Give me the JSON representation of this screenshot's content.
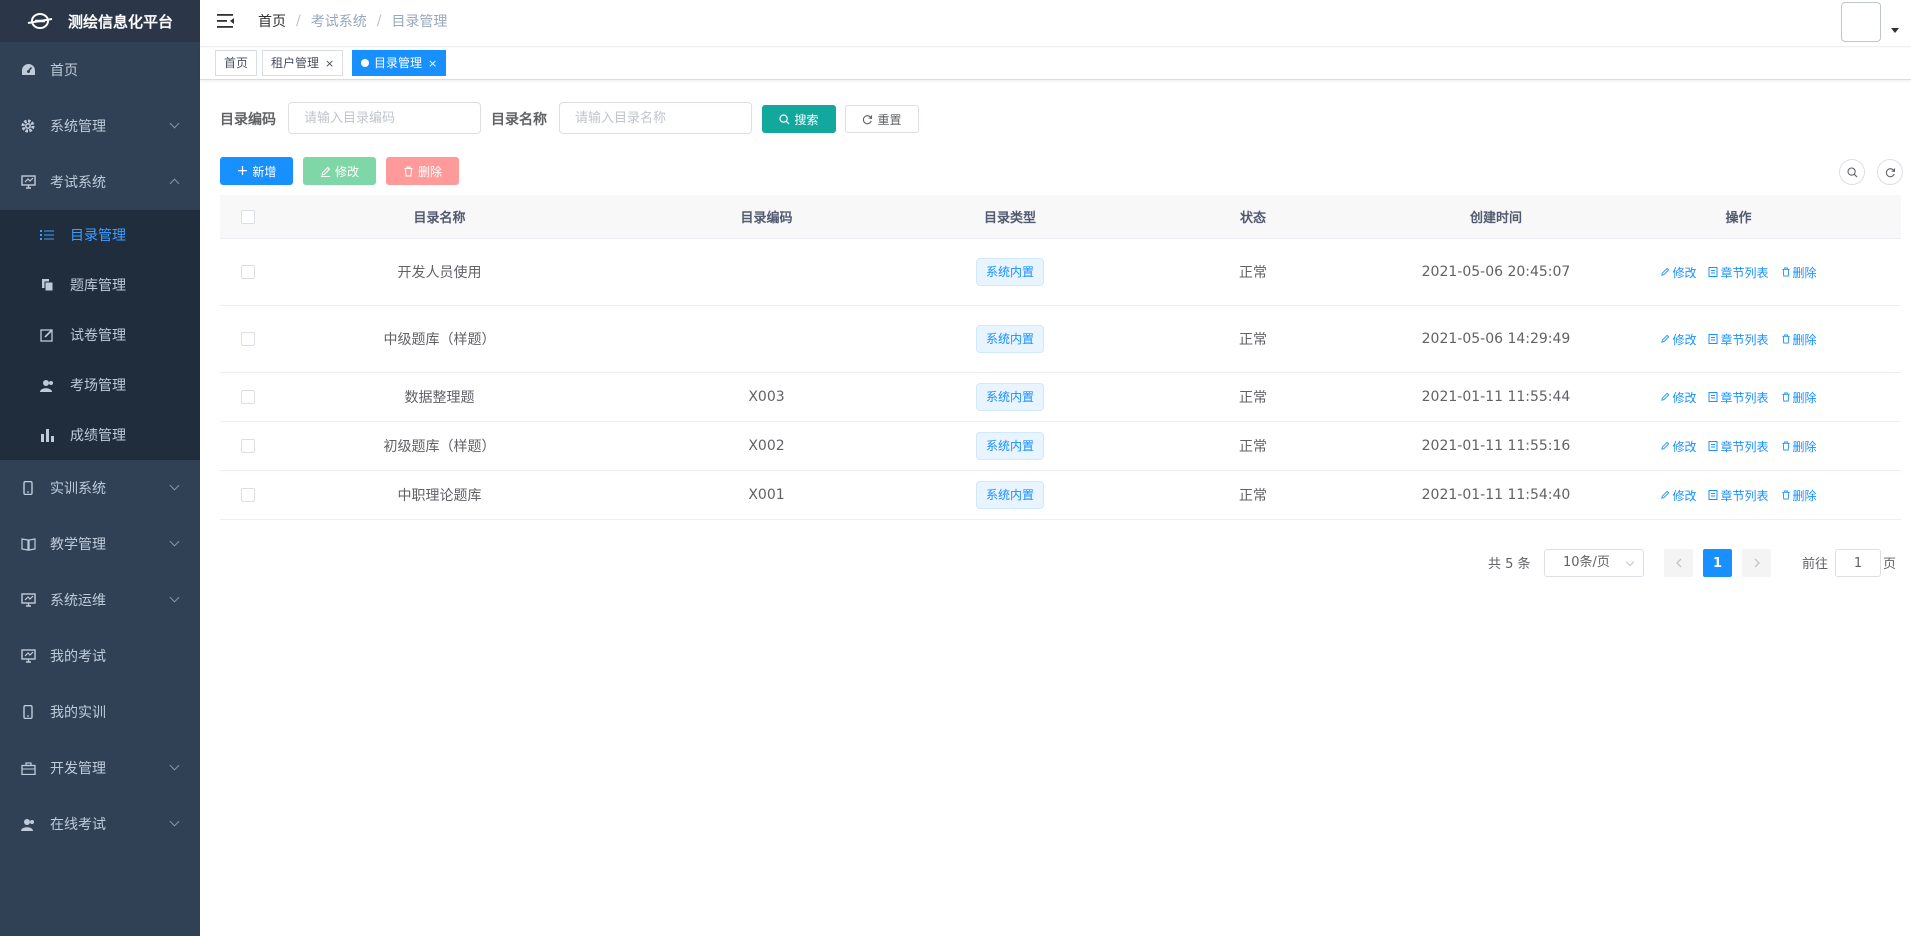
{
  "app": {
    "title": "测绘信息化平台"
  },
  "sidebar": {
    "items": [
      {
        "label": "首页",
        "icon": "dashboard-icon"
      },
      {
        "label": "系统管理",
        "icon": "gear-icon"
      },
      {
        "label": "考试系统",
        "icon": "monitor-icon",
        "expanded": true
      },
      {
        "label": "实训系统",
        "icon": "phone-icon"
      },
      {
        "label": "教学管理",
        "icon": "book-icon"
      },
      {
        "label": "系统运维",
        "icon": "monitor-icon"
      },
      {
        "label": "我的考试",
        "icon": "monitor-icon"
      },
      {
        "label": "我的实训",
        "icon": "phone-icon"
      },
      {
        "label": "开发管理",
        "icon": "briefcase-icon"
      },
      {
        "label": "在线考试",
        "icon": "peoples-icon"
      }
    ],
    "exam_sub": [
      {
        "label": "目录管理",
        "icon": "list-icon",
        "active": true
      },
      {
        "label": "题库管理",
        "icon": "documents-icon"
      },
      {
        "label": "试卷管理",
        "icon": "edit-icon"
      },
      {
        "label": "考场管理",
        "icon": "peoples-icon"
      },
      {
        "label": "成绩管理",
        "icon": "chart-icon"
      }
    ]
  },
  "breadcrumb": [
    "首页",
    "考试系统",
    "目录管理"
  ],
  "tags": [
    {
      "label": "首页"
    },
    {
      "label": "租户管理",
      "close": "×"
    },
    {
      "label": "目录管理",
      "close": "×",
      "active": true
    }
  ],
  "search": {
    "code_label": "目录编码",
    "code_placeholder": "请输入目录编码",
    "name_label": "目录名称",
    "name_placeholder": "请输入目录名称",
    "search_btn": "搜索",
    "reset_btn": "重置"
  },
  "toolbar": {
    "add": "新增",
    "edit": "修改",
    "delete": "删除"
  },
  "table": {
    "headers": [
      "目录名称",
      "目录编码",
      "目录类型",
      "状态",
      "创建时间",
      "操作"
    ],
    "rows": [
      {
        "name": "开发人员使用",
        "code": "",
        "type": "系统内置",
        "status": "正常",
        "time": "2021-05-06 20:45:07"
      },
      {
        "name": "中级题库（样题）",
        "code": "",
        "type": "系统内置",
        "status": "正常",
        "time": "2021-05-06 14:29:49"
      },
      {
        "name": "数据整理题",
        "code": "X003",
        "type": "系统内置",
        "status": "正常",
        "time": "2021-01-11 11:55:44"
      },
      {
        "name": "初级题库（样题）",
        "code": "X002",
        "type": "系统内置",
        "status": "正常",
        "time": "2021-01-11 11:55:16"
      },
      {
        "name": "中职理论题库",
        "code": "X001",
        "type": "系统内置",
        "status": "正常",
        "time": "2021-01-11 11:54:40"
      }
    ],
    "ops": {
      "edit": "修改",
      "chapters": "章节列表",
      "delete": "删除"
    }
  },
  "pagination": {
    "total": "共 5 条",
    "size": "10条/页",
    "current": "1",
    "goto_label": "前往",
    "goto_value": "1",
    "page_suffix": "页"
  },
  "colors": {
    "sidebar_bg": "#304156",
    "submenu_bg": "#1f2d3d",
    "primary": "#1890ff",
    "success_teal": "#13a89e"
  }
}
